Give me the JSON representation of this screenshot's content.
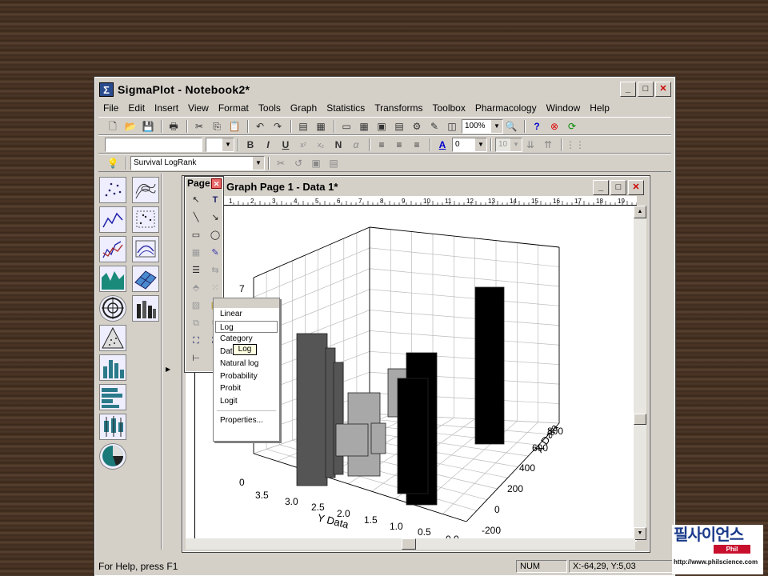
{
  "window": {
    "title": "SigmaPlot - Notebook2*",
    "icon_name": "sigma-icon"
  },
  "menu": [
    "File",
    "Edit",
    "Insert",
    "View",
    "Format",
    "Tools",
    "Graph",
    "Statistics",
    "Transforms",
    "Toolbox",
    "Pharmacology",
    "Window",
    "Help"
  ],
  "toolbar": {
    "zoom": "100%",
    "line_width": "0",
    "font_size": "10",
    "analysis_combo": "Survival LogRank"
  },
  "page_palette": {
    "title": "Page"
  },
  "document": {
    "title": "Graph Page 1 - Data 1*"
  },
  "context_menu": {
    "items": [
      "Linear",
      "Log",
      "Category",
      "Date/Time",
      "Natural log",
      "Probability",
      "Probit",
      "Logit"
    ],
    "properties": "Properties...",
    "highlighted": "Log"
  },
  "tooltip": "Log",
  "ruler": {
    "numbers": [
      "1",
      "2",
      "3",
      "4",
      "5",
      "6",
      "7",
      "8",
      "9",
      "10",
      "11",
      "12",
      "13",
      "14",
      "15",
      "16",
      "17",
      "18",
      "19"
    ]
  },
  "chart_data": {
    "type": "bar",
    "subtype": "3D bar",
    "ylabel": "Y Data",
    "xlabel": "X Data",
    "z_ticks": [
      "0",
      "7"
    ],
    "y_ticks": [
      "3.5",
      "3.0",
      "2.5",
      "2.0",
      "1.5",
      "1.0",
      "0.5",
      "0.0"
    ],
    "x_ticks": [
      "-200",
      "0",
      "200",
      "400",
      "600",
      "800"
    ],
    "bar_colors": [
      "#555555",
      "#a8a8a8",
      "#000000"
    ]
  },
  "status": {
    "help": "For Help, press F1",
    "num": "NUM",
    "coords": "X:-64,29, Y:5,03"
  },
  "logo": {
    "korean": "필사이언스",
    "sub": "Phil Science",
    "url": "http://www.philscience.com"
  }
}
